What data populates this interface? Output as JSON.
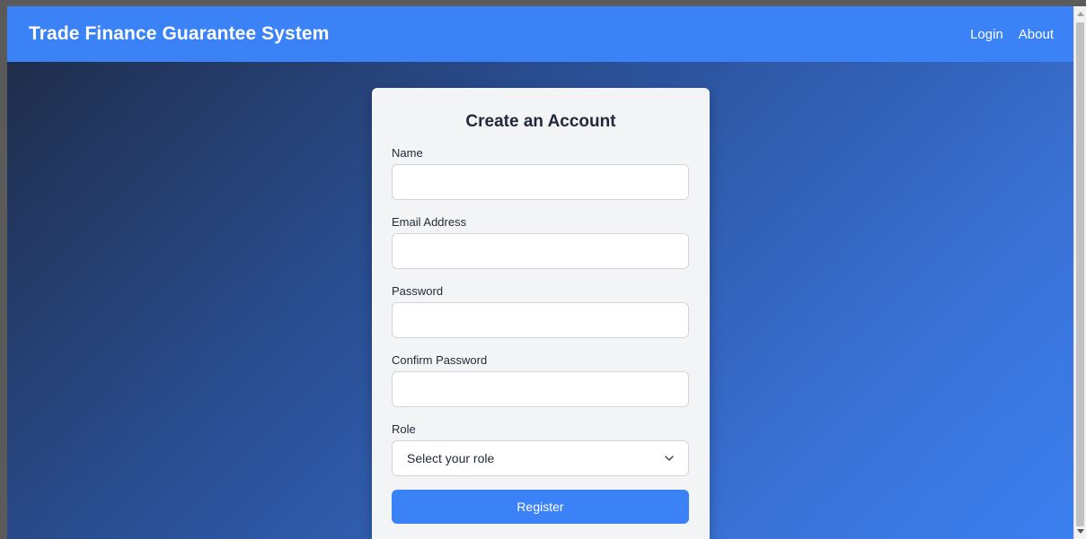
{
  "header": {
    "brand": "Trade Finance Guarantee System",
    "nav": [
      {
        "label": "Login"
      },
      {
        "label": "About"
      }
    ],
    "color": "#3b82f6"
  },
  "form": {
    "title": "Create an Account",
    "fields": [
      {
        "label": "Name",
        "value": "",
        "placeholder": ""
      },
      {
        "label": "Email Address",
        "value": "",
        "placeholder": ""
      },
      {
        "label": "Password",
        "value": "",
        "placeholder": ""
      },
      {
        "label": "Confirm Password",
        "value": "",
        "placeholder": ""
      }
    ],
    "role": {
      "label": "Role",
      "selected": "Select your role"
    },
    "submit_label": "Register",
    "accent": "#3b82f6"
  },
  "icons": {
    "select_arrow": "chevron-down-icon"
  }
}
